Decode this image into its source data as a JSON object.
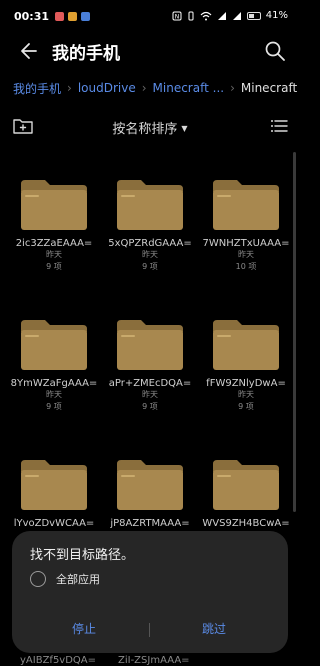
{
  "status_bar": {
    "time": "00:31",
    "app_icons": [
      {
        "name": "notification-icon-1",
        "color": "#e05a5a"
      },
      {
        "name": "notification-icon-2",
        "color": "#e0a030"
      },
      {
        "name": "notification-icon-3",
        "color": "#4a7fd8"
      }
    ],
    "battery": "41%"
  },
  "header": {
    "title": "我的手机"
  },
  "breadcrumb": [
    {
      "label": "我的手机",
      "current": false
    },
    {
      "label": "loudDrive",
      "current": false
    },
    {
      "label": "Minecraft ...",
      "current": false
    },
    {
      "label": "Minecraft ...",
      "current": true
    }
  ],
  "toolbar": {
    "sort_label": "按名称排序"
  },
  "folders": [
    {
      "name": "2ic3ZZaEAAA=",
      "date": "昨天",
      "count": "9 项"
    },
    {
      "name": "5xQPZRdGAAA=",
      "date": "昨天",
      "count": "9 项"
    },
    {
      "name": "7WNHZTxUAAA=",
      "date": "昨天",
      "count": "10 项"
    },
    {
      "name": "8YmWZaFgAAA=",
      "date": "昨天",
      "count": "9 项"
    },
    {
      "name": "aPr+ZMEcDQA=",
      "date": "昨天",
      "count": "9 项"
    },
    {
      "name": "fFW9ZNlyDwA=",
      "date": "昨天",
      "count": "9 项"
    },
    {
      "name": "lYvoZDvWCAA=",
      "date": "",
      "count": ""
    },
    {
      "name": "jP8AZRTMAAA=",
      "date": "",
      "count": ""
    },
    {
      "name": "WVS9ZH4BCwA=",
      "date": "",
      "count": ""
    }
  ],
  "peek_names": [
    "yAIBZf5vDQA=",
    "ZiI-ZSJmAAA="
  ],
  "dialog": {
    "title": "找不到目标路径。",
    "option_label": "全部应用",
    "stop_label": "停止",
    "skip_label": "跳过"
  },
  "colors": {
    "accent": "#5a8be6",
    "folder": "#a8884f",
    "folder_tab": "#8a6e3c",
    "background": "#000000"
  }
}
